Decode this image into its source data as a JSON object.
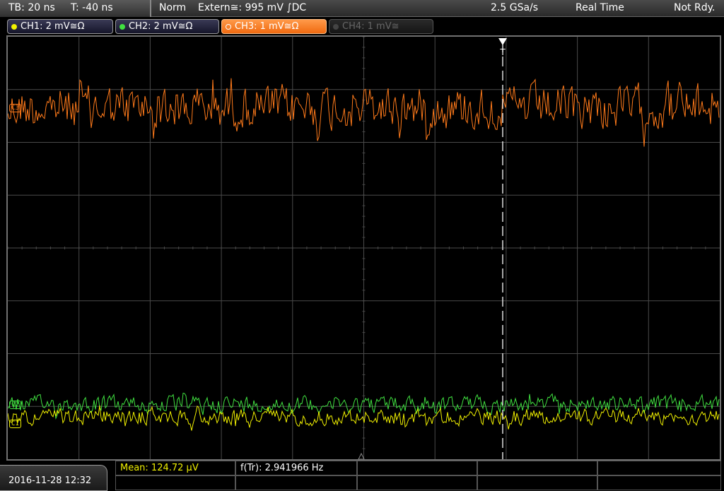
{
  "top_bar": {
    "timebase": "TB: 20 ns",
    "trigger_time": "T: -40 ns",
    "trigger_mode": "Norm",
    "trigger_source": "Extern≅: 995 mV ∫DC",
    "sample_rate": "2.5 GSa/s",
    "acq_mode": "Real Time",
    "status": "Not Rdy."
  },
  "channels": [
    {
      "label": "CH1: 2 mV≅Ω",
      "color": "#f0f000",
      "state": "on"
    },
    {
      "label": "CH2: 2 mV≅Ω",
      "color": "#40e040",
      "state": "on"
    },
    {
      "label": "CH3: 1 mV≅Ω",
      "color": "#ff7a1a",
      "state": "selected"
    },
    {
      "label": "CH4: 1 mV≅",
      "color": "#5a5a5a",
      "state": "off"
    }
  ],
  "screen_markers": {
    "ch3": "C3",
    "ch2": "C2",
    "ch1": "C1",
    "trigger": "T"
  },
  "measurements": {
    "mean": "Mean: 124.72 µV",
    "frequency": "f(Tr): 2.941966 Hz"
  },
  "datetime": "2016-11-28 12:32",
  "colors": {
    "ch1": "#f0f000",
    "ch2": "#40e040",
    "ch3": "#ff7a1a",
    "grid": "#4a4a4a",
    "trigger": "#ffffff"
  }
}
